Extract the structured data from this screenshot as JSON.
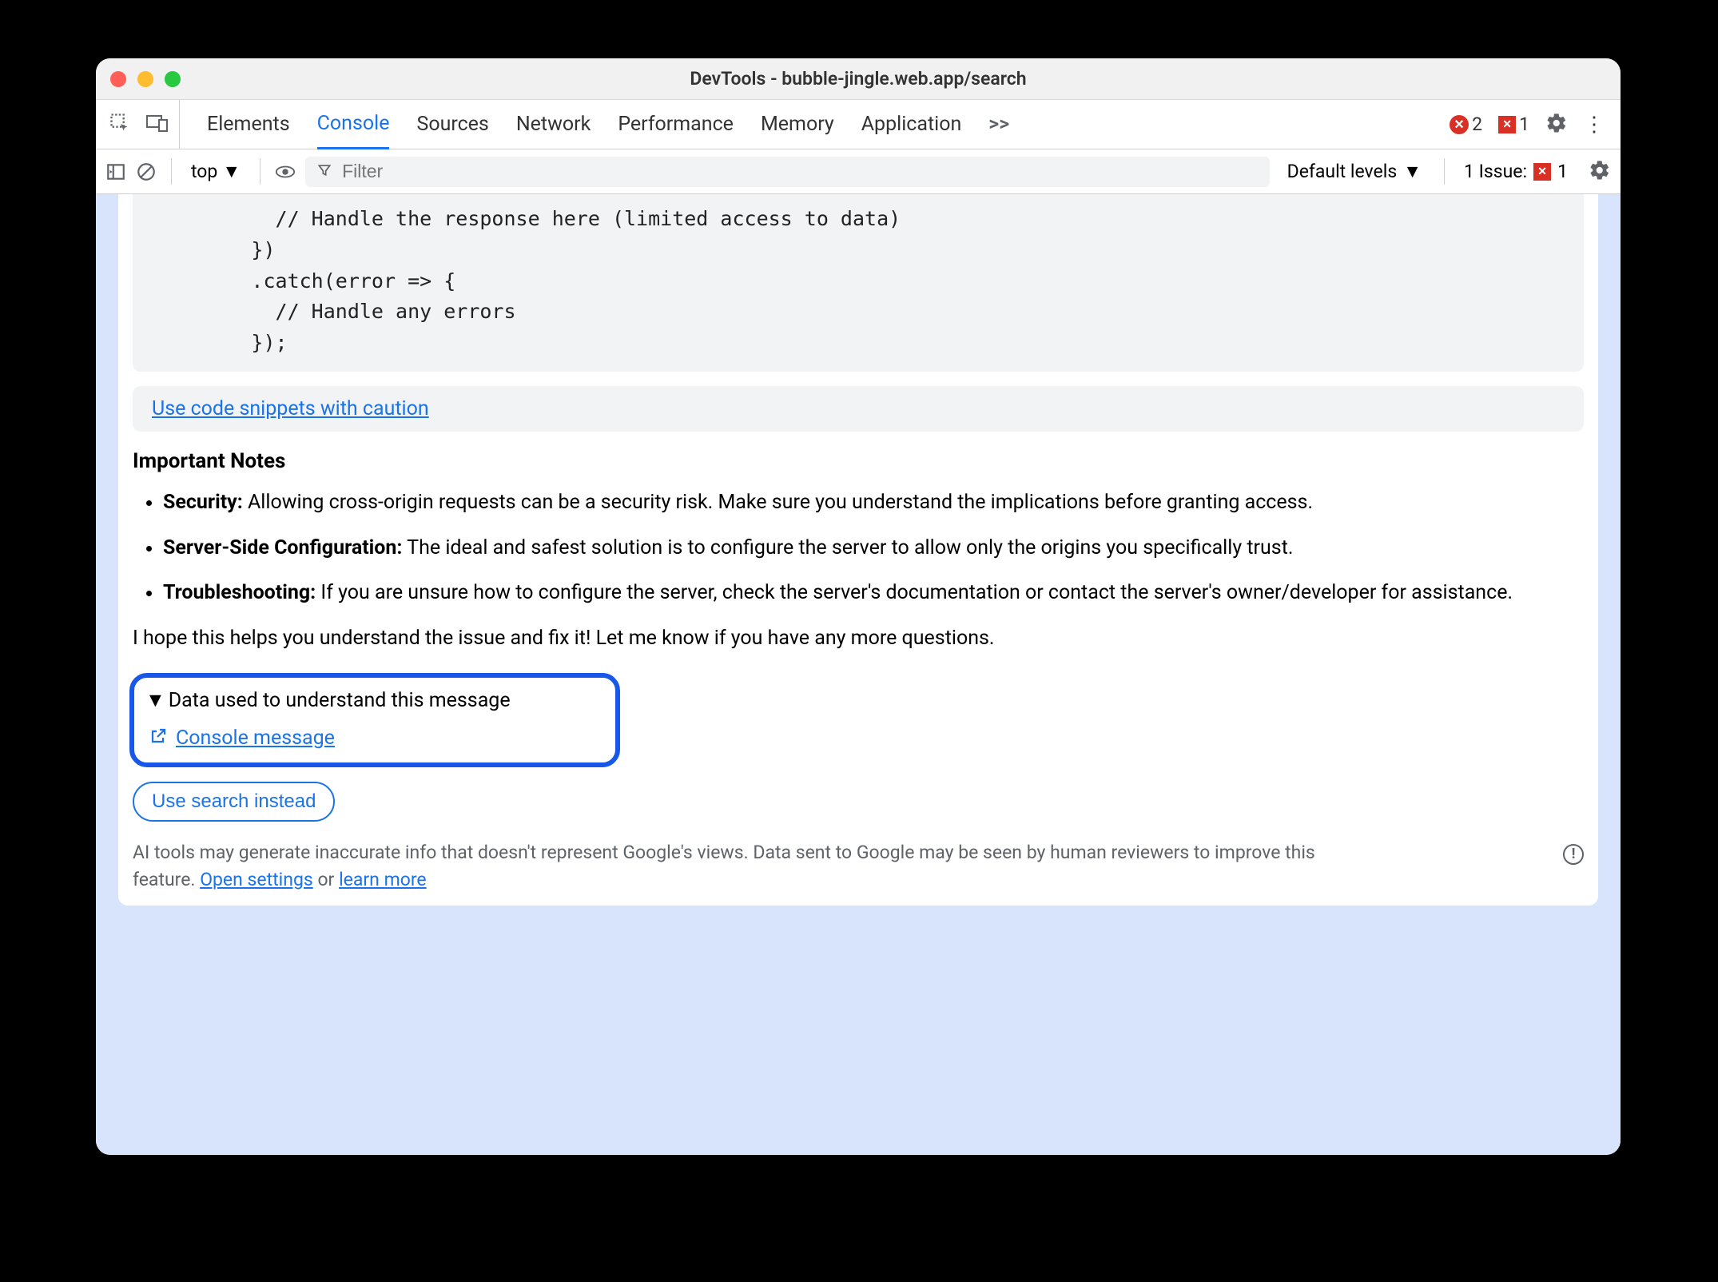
{
  "window": {
    "title": "DevTools - bubble-jingle.web.app/search"
  },
  "tabs": {
    "items": [
      "Elements",
      "Console",
      "Sources",
      "Network",
      "Performance",
      "Memory",
      "Application"
    ],
    "active": "Console",
    "more": ">>",
    "errors_count": "2",
    "issues_count": "1"
  },
  "toolbar": {
    "context": "top",
    "filter_placeholder": "Filter",
    "levels_label": "Default levels",
    "issues_label": "1 Issue:",
    "issues_badge": "1"
  },
  "code": "          // Handle the response here (limited access to data)\n        })\n        .catch(error => {\n          // Handle any errors\n        });",
  "caution_link": "Use code snippets with caution",
  "notes": {
    "heading": "Important Notes",
    "items": [
      {
        "label": "Security:",
        "text": " Allowing cross-origin requests can be a security risk. Make sure you understand the implications before granting access."
      },
      {
        "label": "Server-Side Configuration:",
        "text": " The ideal and safest solution is to configure the server to allow only the origins you specifically trust."
      },
      {
        "label": "Troubleshooting:",
        "text": " If you are unsure how to configure the server, check the server's documentation or contact the server's owner/developer for assistance."
      }
    ]
  },
  "closing": "I hope this helps you understand the issue and fix it! Let me know if you have any more questions.",
  "data_used": {
    "summary": "Data used to understand this message",
    "link": "Console message"
  },
  "search_button": "Use search instead",
  "footer": {
    "text_1": "AI tools may generate inaccurate info that doesn't represent Google's views. Data sent to Google may be seen by human reviewers to improve this feature. ",
    "open_settings": "Open settings",
    "or": " or ",
    "learn_more": "learn more"
  }
}
